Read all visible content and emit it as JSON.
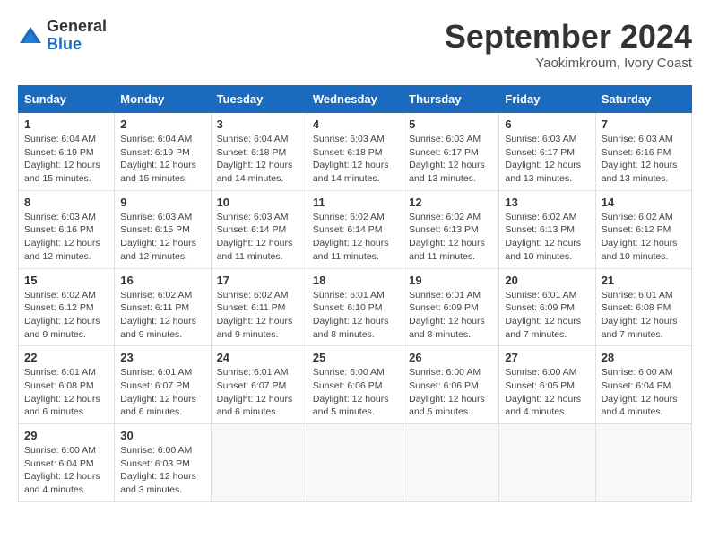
{
  "logo": {
    "general": "General",
    "blue": "Blue"
  },
  "header": {
    "month": "September 2024",
    "location": "Yaokimkroum, Ivory Coast"
  },
  "weekdays": [
    "Sunday",
    "Monday",
    "Tuesday",
    "Wednesday",
    "Thursday",
    "Friday",
    "Saturday"
  ],
  "weeks": [
    [
      {
        "day": 1,
        "sunrise": "6:04 AM",
        "sunset": "6:19 PM",
        "daylight": "12 hours and 15 minutes."
      },
      {
        "day": 2,
        "sunrise": "6:04 AM",
        "sunset": "6:19 PM",
        "daylight": "12 hours and 15 minutes."
      },
      {
        "day": 3,
        "sunrise": "6:04 AM",
        "sunset": "6:18 PM",
        "daylight": "12 hours and 14 minutes."
      },
      {
        "day": 4,
        "sunrise": "6:03 AM",
        "sunset": "6:18 PM",
        "daylight": "12 hours and 14 minutes."
      },
      {
        "day": 5,
        "sunrise": "6:03 AM",
        "sunset": "6:17 PM",
        "daylight": "12 hours and 13 minutes."
      },
      {
        "day": 6,
        "sunrise": "6:03 AM",
        "sunset": "6:17 PM",
        "daylight": "12 hours and 13 minutes."
      },
      {
        "day": 7,
        "sunrise": "6:03 AM",
        "sunset": "6:16 PM",
        "daylight": "12 hours and 13 minutes."
      }
    ],
    [
      {
        "day": 8,
        "sunrise": "6:03 AM",
        "sunset": "6:16 PM",
        "daylight": "12 hours and 12 minutes."
      },
      {
        "day": 9,
        "sunrise": "6:03 AM",
        "sunset": "6:15 PM",
        "daylight": "12 hours and 12 minutes."
      },
      {
        "day": 10,
        "sunrise": "6:03 AM",
        "sunset": "6:14 PM",
        "daylight": "12 hours and 11 minutes."
      },
      {
        "day": 11,
        "sunrise": "6:02 AM",
        "sunset": "6:14 PM",
        "daylight": "12 hours and 11 minutes."
      },
      {
        "day": 12,
        "sunrise": "6:02 AM",
        "sunset": "6:13 PM",
        "daylight": "12 hours and 11 minutes."
      },
      {
        "day": 13,
        "sunrise": "6:02 AM",
        "sunset": "6:13 PM",
        "daylight": "12 hours and 10 minutes."
      },
      {
        "day": 14,
        "sunrise": "6:02 AM",
        "sunset": "6:12 PM",
        "daylight": "12 hours and 10 minutes."
      }
    ],
    [
      {
        "day": 15,
        "sunrise": "6:02 AM",
        "sunset": "6:12 PM",
        "daylight": "12 hours and 9 minutes."
      },
      {
        "day": 16,
        "sunrise": "6:02 AM",
        "sunset": "6:11 PM",
        "daylight": "12 hours and 9 minutes."
      },
      {
        "day": 17,
        "sunrise": "6:02 AM",
        "sunset": "6:11 PM",
        "daylight": "12 hours and 9 minutes."
      },
      {
        "day": 18,
        "sunrise": "6:01 AM",
        "sunset": "6:10 PM",
        "daylight": "12 hours and 8 minutes."
      },
      {
        "day": 19,
        "sunrise": "6:01 AM",
        "sunset": "6:09 PM",
        "daylight": "12 hours and 8 minutes."
      },
      {
        "day": 20,
        "sunrise": "6:01 AM",
        "sunset": "6:09 PM",
        "daylight": "12 hours and 7 minutes."
      },
      {
        "day": 21,
        "sunrise": "6:01 AM",
        "sunset": "6:08 PM",
        "daylight": "12 hours and 7 minutes."
      }
    ],
    [
      {
        "day": 22,
        "sunrise": "6:01 AM",
        "sunset": "6:08 PM",
        "daylight": "12 hours and 6 minutes."
      },
      {
        "day": 23,
        "sunrise": "6:01 AM",
        "sunset": "6:07 PM",
        "daylight": "12 hours and 6 minutes."
      },
      {
        "day": 24,
        "sunrise": "6:01 AM",
        "sunset": "6:07 PM",
        "daylight": "12 hours and 6 minutes."
      },
      {
        "day": 25,
        "sunrise": "6:00 AM",
        "sunset": "6:06 PM",
        "daylight": "12 hours and 5 minutes."
      },
      {
        "day": 26,
        "sunrise": "6:00 AM",
        "sunset": "6:06 PM",
        "daylight": "12 hours and 5 minutes."
      },
      {
        "day": 27,
        "sunrise": "6:00 AM",
        "sunset": "6:05 PM",
        "daylight": "12 hours and 4 minutes."
      },
      {
        "day": 28,
        "sunrise": "6:00 AM",
        "sunset": "6:04 PM",
        "daylight": "12 hours and 4 minutes."
      }
    ],
    [
      {
        "day": 29,
        "sunrise": "6:00 AM",
        "sunset": "6:04 PM",
        "daylight": "12 hours and 4 minutes."
      },
      {
        "day": 30,
        "sunrise": "6:00 AM",
        "sunset": "6:03 PM",
        "daylight": "12 hours and 3 minutes."
      },
      null,
      null,
      null,
      null,
      null
    ]
  ]
}
